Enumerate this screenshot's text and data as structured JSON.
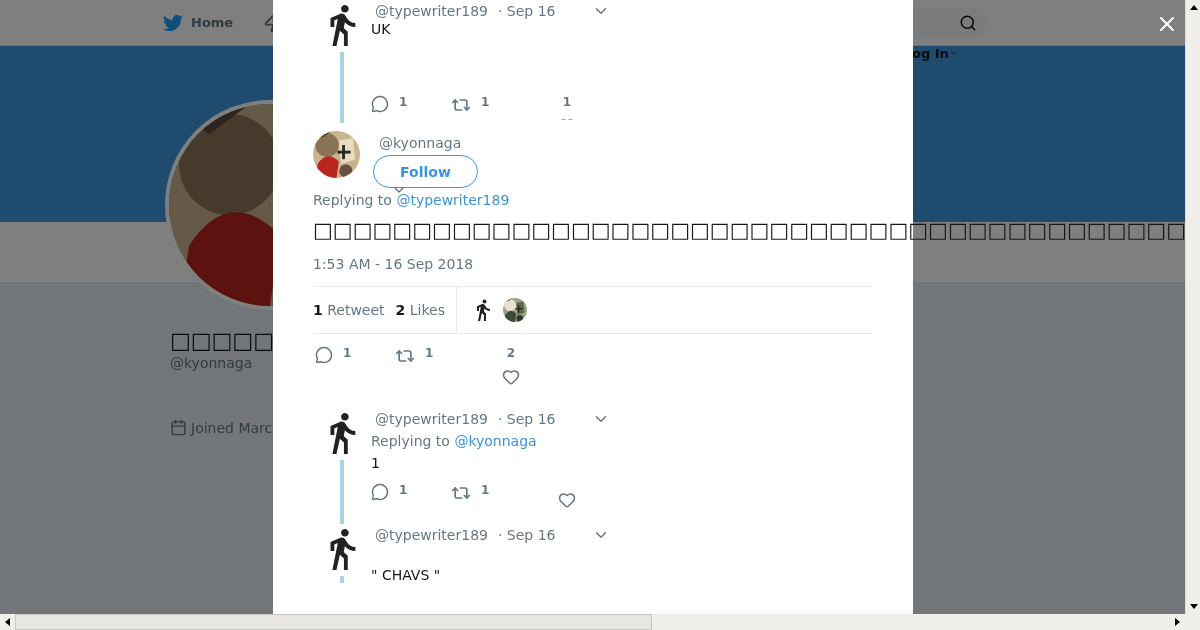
{
  "nav": {
    "home_label": "Home",
    "login_label": "og In"
  },
  "profile": {
    "name": "□□□□□",
    "handle": "@kyonnaga",
    "joined": "Joined Marc"
  },
  "thread": [
    {
      "kind": "reply",
      "handle": "@typewriter189",
      "date": "· Sep 16",
      "text": "UK",
      "replies": "1",
      "retweets": "1",
      "likes": "1"
    },
    {
      "kind": "main",
      "handle": "@kyonnaga",
      "follow": "Follow",
      "replying_prefix": "Replying to",
      "replying_to": "@typewriter189",
      "text": "□□□□□□□□□□□□□□□□□□□□□□□□□□□□□□□□□□□□□□□□□□□□",
      "timestamp": "1:53 AM - 16 Sep 2018",
      "retweet_count": "1",
      "retweet_label": "Retweet",
      "like_count": "2",
      "like_label": "Likes",
      "replies": "1",
      "retweets": "1",
      "likes": "2"
    },
    {
      "kind": "reply",
      "handle": "@typewriter189",
      "date": "· Sep 16",
      "replying_prefix": "Replying to",
      "replying_to": "@kyonnaga",
      "text": "1",
      "replies": "1",
      "retweets": "1"
    },
    {
      "kind": "reply",
      "handle": "@typewriter189",
      "date": "· Sep 16",
      "text": "\" CHAVS \""
    }
  ]
}
